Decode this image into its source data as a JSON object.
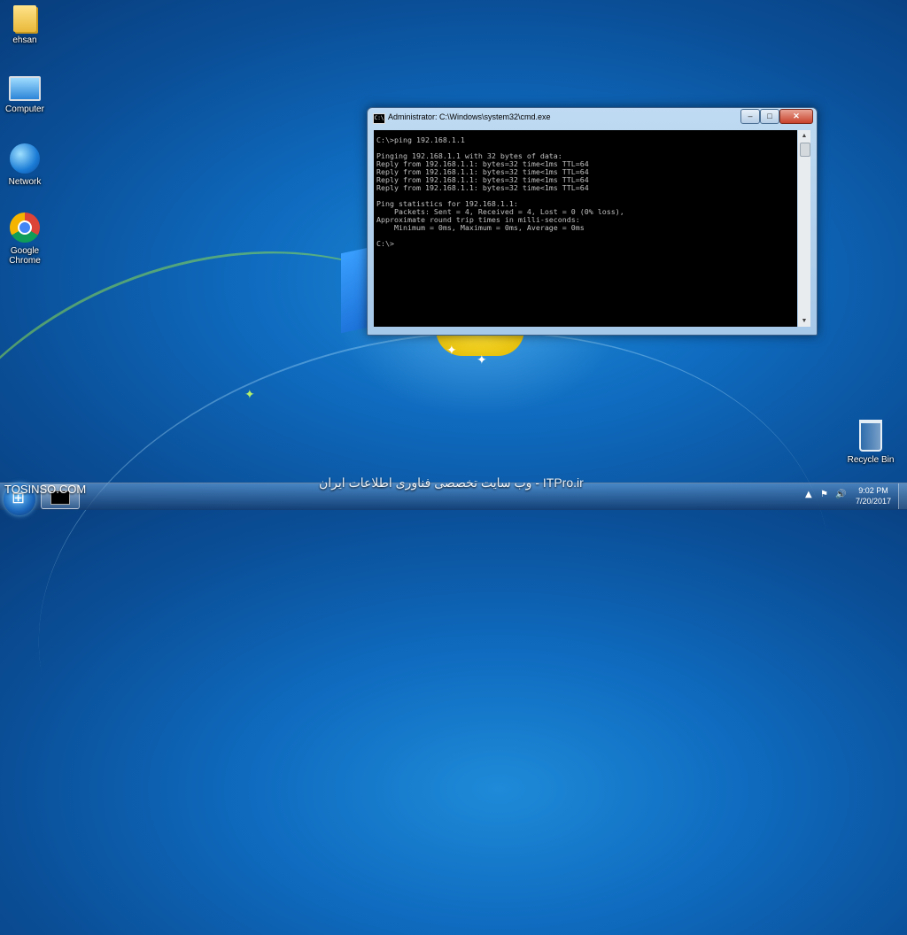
{
  "desktop": {
    "icons": [
      {
        "label": "ehsan",
        "icon": "folder-icon"
      },
      {
        "label": "Computer",
        "icon": "computer-icon"
      },
      {
        "label": "Network",
        "icon": "network-icon"
      },
      {
        "label": "Google Chrome",
        "icon": "chrome-icon"
      },
      {
        "label": "Recycle Bin",
        "icon": "recycle-bin-icon"
      }
    ]
  },
  "cmd": {
    "title": "Administrator: C:\\Windows\\system32\\cmd.exe",
    "icon_text": "C:\\",
    "min": "‒",
    "max": "□",
    "close": "✕",
    "lines": [
      "C:\\>ping 192.168.1.1",
      "",
      "Pinging 192.168.1.1 with 32 bytes of data:",
      "Reply from 192.168.1.1: bytes=32 time<1ms TTL=64",
      "Reply from 192.168.1.1: bytes=32 time<1ms TTL=64",
      "Reply from 192.168.1.1: bytes=32 time<1ms TTL=64",
      "Reply from 192.168.1.1: bytes=32 time<1ms TTL=64",
      "",
      "Ping statistics for 192.168.1.1:",
      "    Packets: Sent = 4, Received = 4, Lost = 0 (0% loss),",
      "Approximate round trip times in milli-seconds:",
      "    Minimum = 0ms, Maximum = 0ms, Average = 0ms",
      "",
      "C:\\>"
    ],
    "scroll_up": "▲",
    "scroll_down": "▼"
  },
  "watermark": {
    "site": "TOSINSO.COM",
    "itpro": "وب سایت تخصصی فناوری اطلاعات ایران - ITPro.ir"
  },
  "taskbar": {
    "tray_arrow": "▲",
    "volume": "🔊",
    "flag": "⚑",
    "time": "9:02 PM",
    "date": "7/20/2017"
  },
  "colors": {
    "desktop_blue": "#0f6bbf",
    "console_bg": "#000000",
    "console_text": "#c0c0c0"
  }
}
